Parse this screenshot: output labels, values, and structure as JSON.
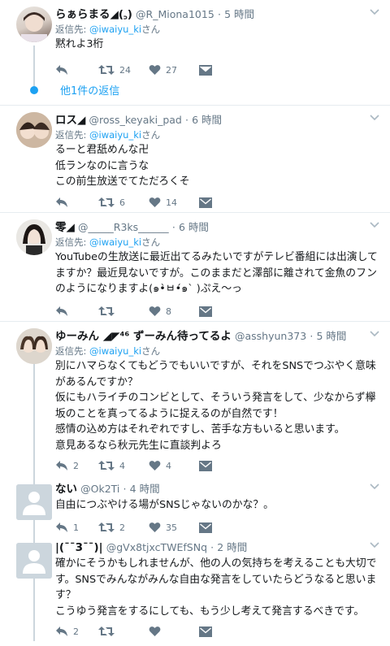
{
  "tweets": [
    {
      "name": "らぁらまる◢(꜆)",
      "handle": "@R_Miona1015",
      "time": "5 時間",
      "reply_label": "返信先: ",
      "reply_to": "@iwaiyu_ki",
      "reply_suffix": "さん",
      "text": "黙れよ3桁",
      "replies": "",
      "retweets": "24",
      "likes": "27"
    },
    {
      "name": "ロス◢",
      "handle": "@ross_keyaki_pad",
      "time": "6 時間",
      "reply_label": "返信先: ",
      "reply_to": "@iwaiyu_ki",
      "reply_suffix": "さん",
      "text": "るーと君舐めんな卍\n低ランなのに言うな\nこの前生放送でてただろくそ",
      "replies": "",
      "retweets": "6",
      "likes": "14"
    },
    {
      "name": "零◢",
      "handle": "@_____R3ks______",
      "time": "6 時間",
      "reply_label": "返信先: ",
      "reply_to": "@iwaiyu_ki",
      "reply_suffix": "さん",
      "text": "YouTubeの生放送に最近出てるみたいですがテレビ番組には出演してますか？最近見ないですが。このままだと澤部に離されて金魚のフンのようになりますよ(๑•̀ㅂ•́๑ˋ )ぷえ〜っ",
      "replies": "",
      "retweets": "",
      "likes": "8"
    },
    {
      "name": "ゆーみん ◢◤⁴⁶ ずーみん待ってるよ",
      "handle": "@asshyun373",
      "time": "5 時間",
      "reply_label": "返信先: ",
      "reply_to": "@iwaiyu_ki",
      "reply_suffix": "さん",
      "text": "別にハマらなくてもどうでもいいですが、それをSNSでつぶやく意味があるんですか？\n仮にもハライチのコンビとして、そういう発言をして、少なからず欅坂のことを真ってるように捉えるのが自然です！\n感情の込め方はそれぞれですし、苦手な方もいると思います。\n意見あるなら秋元先生に直談判よろ",
      "replies": "2",
      "retweets": "4",
      "likes": "4"
    },
    {
      "name": "ない",
      "handle": "@Ok2Ti",
      "time": "4 時間",
      "text": "自由につぶやける場がSNSじゃないのかな？。",
      "replies": "1",
      "retweets": "2",
      "likes": "35"
    },
    {
      "name": "|(¯¯3¯¯)|",
      "handle": "@gVx8tjxcTWEfSNq",
      "time": "2 時間",
      "text": "確かにそうかもしれませんが、他の人の気持ちを考えることも大切です。SNSでみんながみんな自由な発言をしていたらどうなると思います？\nこうゆう発言をするにしても、もう少し考えて発言するべきです。",
      "replies": "2",
      "retweets": "",
      "likes": ""
    }
  ],
  "more_replies_label": "他1件の返信",
  "dot_separator": "·",
  "colors": {
    "link": "#1da1f2",
    "muted": "#657786",
    "border": "#e6ecf0"
  },
  "icons": [
    "reply-icon",
    "retweet-icon",
    "like-icon",
    "dm-icon",
    "chevron-down-icon"
  ]
}
